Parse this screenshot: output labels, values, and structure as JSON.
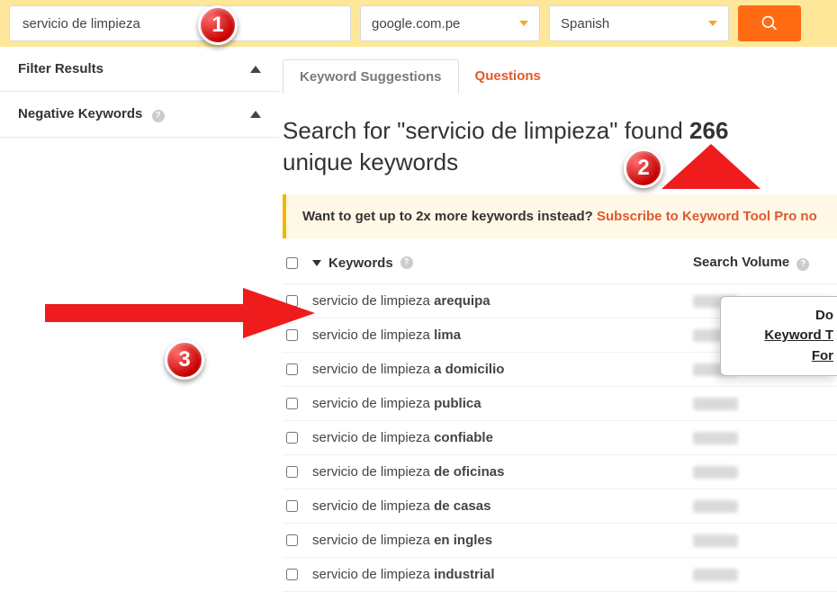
{
  "search": {
    "query": "servicio de limpieza",
    "domain": "google.com.pe",
    "lang": "Spanish"
  },
  "sidebar": {
    "filter_label": "Filter Results",
    "negative_label": "Negative Keywords"
  },
  "tabs": {
    "suggestions": "Keyword Suggestions",
    "questions": "Questions"
  },
  "result": {
    "heading_pre": "Search for \"",
    "heading_term": "servicio de limpieza",
    "heading_mid": "\" found ",
    "heading_count": "266",
    "heading_post": " unique keywords"
  },
  "promo": {
    "text": "Want to get up to 2x more keywords instead? ",
    "link": "Subscribe to Keyword Tool Pro no"
  },
  "columns": {
    "keywords": "Keywords",
    "volume": "Search Volume"
  },
  "rows": [
    {
      "base": "servicio de limpieza ",
      "bold": "arequipa"
    },
    {
      "base": "servicio de limpieza ",
      "bold": "lima"
    },
    {
      "base": "servicio de limpieza ",
      "bold": "a domicilio"
    },
    {
      "base": "servicio de limpieza ",
      "bold": "publica"
    },
    {
      "base": "servicio de limpieza ",
      "bold": "confiable"
    },
    {
      "base": "servicio de limpieza ",
      "bold": "de oficinas"
    },
    {
      "base": "servicio de limpieza ",
      "bold": "de casas"
    },
    {
      "base": "servicio de limpieza ",
      "bold": "en ingles"
    },
    {
      "base": "servicio de limpieza ",
      "bold": "industrial"
    }
  ],
  "popup": {
    "line1": "Do",
    "line2": "Keyword T",
    "line3": "For"
  },
  "badges": {
    "b1": "1",
    "b2": "2",
    "b3": "3"
  }
}
